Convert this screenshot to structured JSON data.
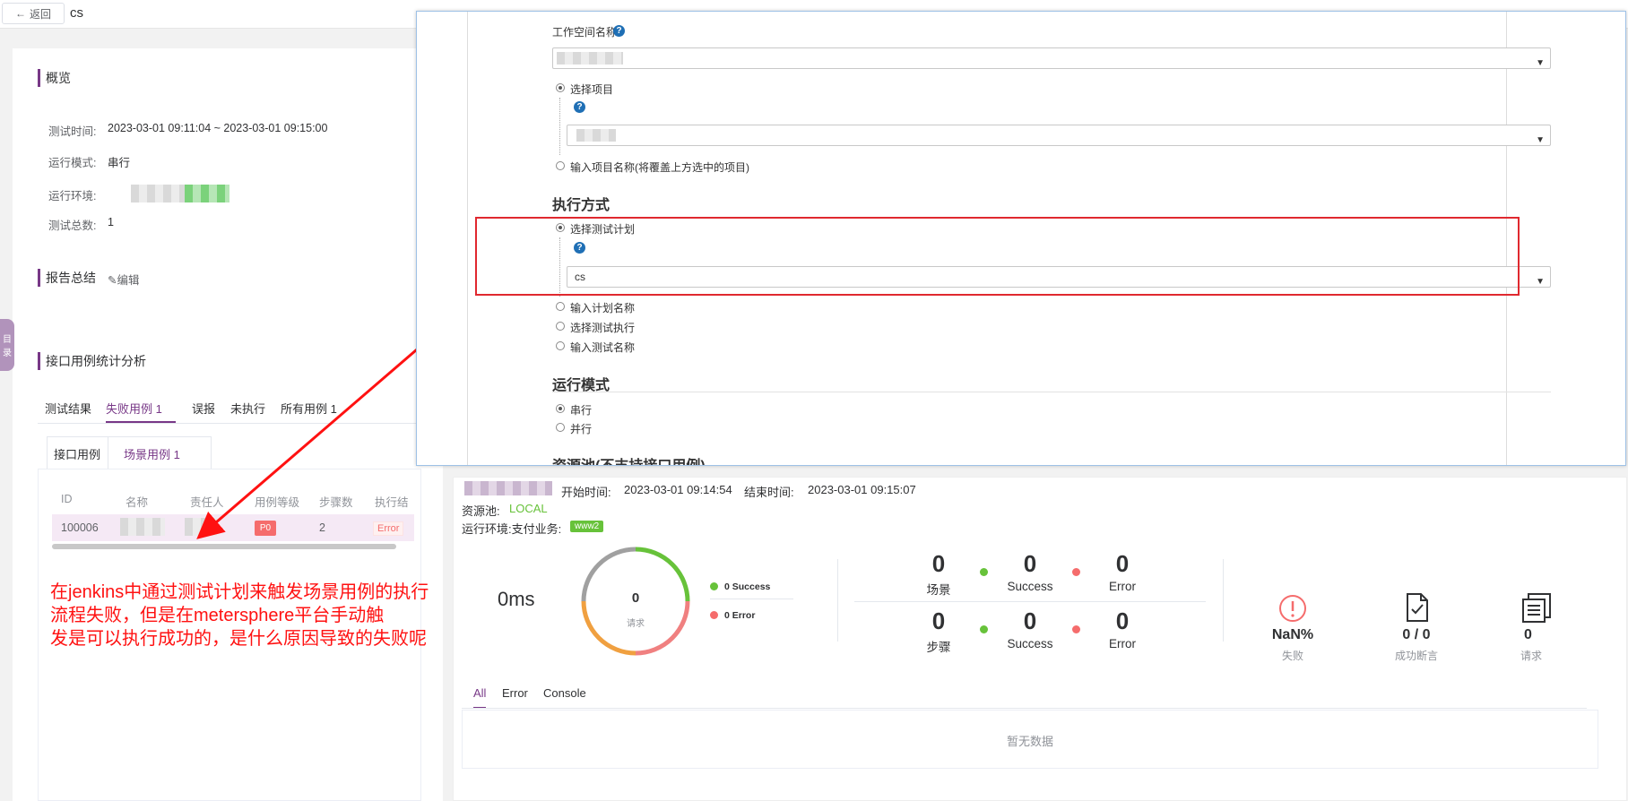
{
  "topbar": {
    "back_label": "返回",
    "plan_name": "cs"
  },
  "overview": {
    "title": "概览",
    "test_time_label": "测试时间:",
    "test_time_value": "2023-03-01 09:11:04 ~ 2023-03-01 09:15:00",
    "run_mode_label": "运行模式:",
    "run_mode_value": "串行",
    "run_env_label": "运行环境:",
    "total_label": "测试总数:",
    "total_value": "1"
  },
  "summary": {
    "title": "报告总结",
    "edit_label": "编辑"
  },
  "side_tab": {
    "label_1": "目",
    "label_2": "录"
  },
  "analysis": {
    "title": "接口用例统计分析",
    "tabs": [
      "测试结果",
      "失败用例 1",
      "误报",
      "未执行",
      "所有用例 1"
    ],
    "sub_tabs": [
      "接口用例",
      "场景用例 1"
    ]
  },
  "case_table": {
    "columns": [
      "ID",
      "名称",
      "责任人",
      "用例等级",
      "步骤数",
      "执行结"
    ],
    "row": {
      "id": "100006",
      "level": "P0",
      "steps": "2",
      "result": "Error"
    }
  },
  "annotation": {
    "lines": [
      "在jenkins中通过测试计划来触发场景用例的执行",
      "流程失败，但是在metersphere平台手动触",
      "发是可以执行成功的，是什么原因导致的失败呢"
    ]
  },
  "jenkins": {
    "workspace_label": "工作空间名称",
    "select_project_label": "选择项目",
    "input_project_label": "输入项目名称(将覆盖上方选中的项目)",
    "exec_mode_title": "执行方式",
    "select_plan_label": "选择测试计划",
    "plan_select_value": "cs",
    "input_plan_label": "输入计划名称",
    "select_exec_label": "选择测试执行",
    "input_test_label": "输入测试名称",
    "run_mode_title": "运行模式",
    "serial_label": "串行",
    "parallel_label": "并行",
    "resource_pool_title": "资源池(不支持接口用例)",
    "help_glyph": "?"
  },
  "result": {
    "start_label": "开始时间:",
    "start_value": "2023-03-01 09:14:54",
    "end_label": "结束时间:",
    "end_value": "2023-03-01 09:15:07",
    "pool_label": "资源池:",
    "pool_value": "LOCAL",
    "env_label": "运行环境:支付业务:",
    "env_tag": "www2",
    "duration": "0ms",
    "donut_value": "0",
    "donut_label": "请求",
    "legend_success": "0 Success",
    "legend_error": "0 Error",
    "scene_count": "0",
    "scene_label": "场景",
    "scene_success": "0",
    "scene_error": "0",
    "step_count": "0",
    "step_label": "步骤",
    "step_success": "0",
    "step_error": "0",
    "success_word": "Success",
    "error_word": "Error",
    "fail_rate": "NaN%",
    "fail_label": "失败",
    "assert_value": "0 / 0",
    "assert_label": "成功断言",
    "req_value": "0",
    "req_label": "请求",
    "tabs": [
      "All",
      "Error",
      "Console"
    ],
    "no_data": "暂无数据",
    "colors": {
      "success": "#67c23a",
      "error": "#f56c6c",
      "accent": "#783887"
    }
  }
}
